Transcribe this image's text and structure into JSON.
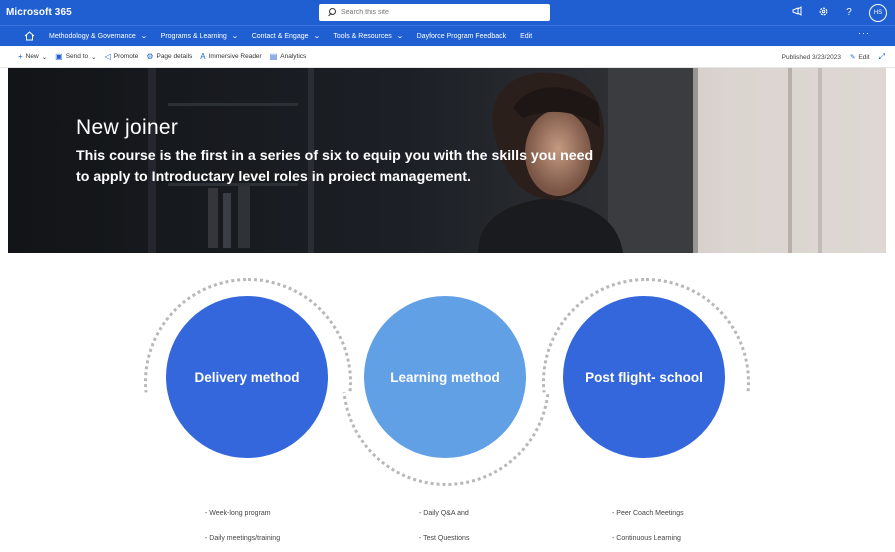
{
  "suite": {
    "brand": "Microsoft 365",
    "search_placeholder": "Search this site",
    "avatar_initials": "HS"
  },
  "hubnav": {
    "items": [
      {
        "label": "Methodology & Governance",
        "dropdown": true
      },
      {
        "label": "Programs & Learning",
        "dropdown": true
      },
      {
        "label": "Contact & Engage",
        "dropdown": true
      },
      {
        "label": "Tools & Resources",
        "dropdown": true
      },
      {
        "label": "Dayforce Program Feedback",
        "dropdown": false
      },
      {
        "label": "Edit",
        "dropdown": false
      }
    ],
    "more": "···"
  },
  "commandbar": {
    "new": "New",
    "send_to": "Send to",
    "promote": "Promote",
    "page_details": "Page details",
    "immersive_reader": "Immersive Reader",
    "analytics": "Analytics",
    "published": "Published 3/23/2023",
    "edit": "Edit"
  },
  "hero": {
    "title": "New joiner",
    "subtitle": "This course is the first in a series of six to equip you with the skills you need to apply to Introductary level roles in proiect management."
  },
  "circles": [
    {
      "label": "Delivery method",
      "color": "#3467db"
    },
    {
      "label": "Learning method",
      "color": "#62a0e6"
    },
    {
      "label": "Post flight- school",
      "color": "#3467db"
    }
  ],
  "bullets": [
    [
      "- Week-long program",
      "- Daily meetings/training"
    ],
    [
      "- Daily Q&A and",
      "- Test Questions"
    ],
    [
      "- Peer Coach Meetings",
      "- Continuous Learning"
    ]
  ],
  "colors": {
    "suite_blue": "#1f5fd1",
    "accent": "#1f5fd1"
  }
}
